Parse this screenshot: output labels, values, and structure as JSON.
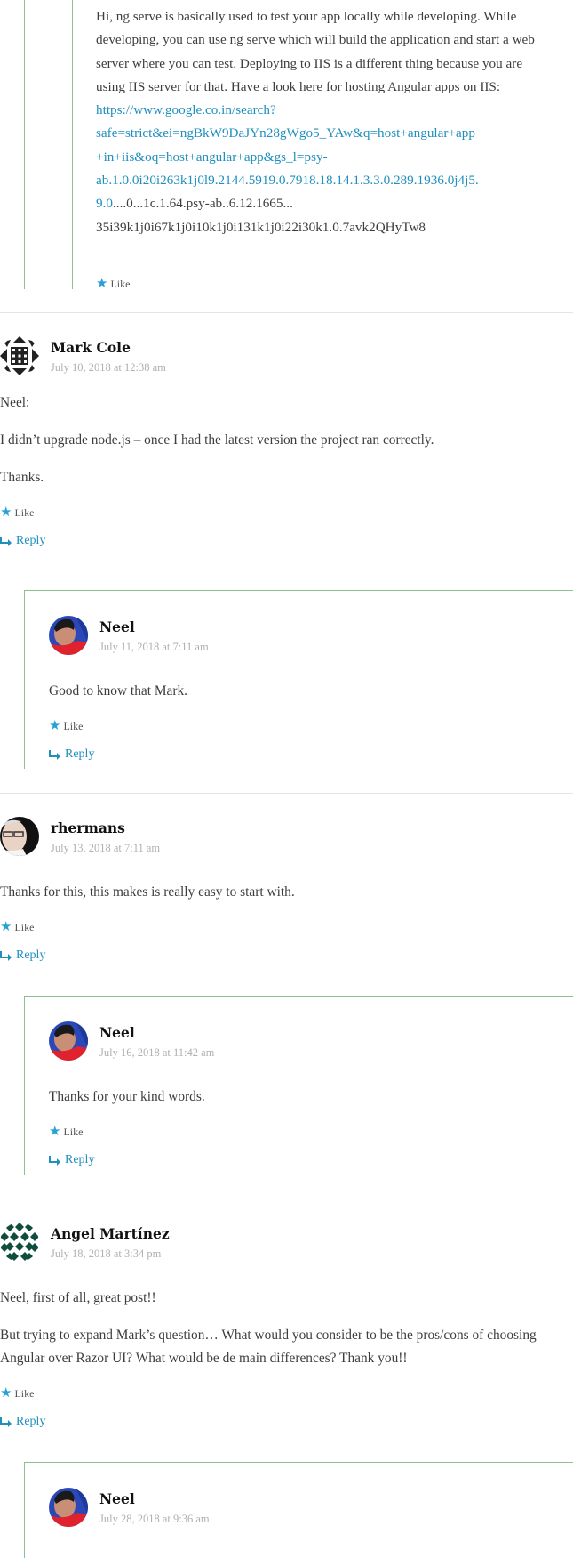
{
  "top_reply": {
    "paragraph_intro": "Hi, ng serve is basically used to test your app locally while developing. While developing, you can use ng serve which will build the application and start a web server where you can test. Deploying to IIS is a different thing because you are using IIS server for that. Have a look here for hosting Angular apps on IIS:",
    "link_text_lines": [
      "https://www.google.co.in/search?",
      "safe=strict&ei=ngBkW9DaJYn28gWgo5_YAw&q=host+angular+app",
      "+in+iis&oq=host+angular+app&gs_l=psy-",
      "ab.1.0.0i20i263k1j0l9.2144.5919.0.7918.18.14.1.3.3.0.289.1936.0j4j5.",
      "9.0"
    ],
    "trailing_text_lines": [
      "....0...1c.1.64.psy-ab..6.12.1665...",
      "35i39k1j0i67k1j0i10k1j0i131k1j0i22i30k1.0.7avk2QHyTw8"
    ],
    "like_label": "Like"
  },
  "comments": [
    {
      "author": "Mark Cole",
      "date": "July 10, 2018 at 12:38 am",
      "avatar": "geometric-identicon-black",
      "paragraphs": [
        "Neel:",
        "I didn’t upgrade node.js – once I had the latest version the project ran correctly.",
        "Thanks."
      ],
      "like_label": "Like",
      "reply_label": "Reply",
      "replies": [
        {
          "author": "Neel",
          "date": "July 11, 2018 at 7:11 am",
          "avatar": "photo-neel",
          "paragraphs": [
            "Good to know that Mark."
          ],
          "like_label": "Like",
          "reply_label": "Reply"
        }
      ]
    },
    {
      "author": "rhermans",
      "date": "July 13, 2018 at 7:11 am",
      "avatar": "photo-rhermans",
      "paragraphs": [
        "Thanks for this, this makes is really easy to start with."
      ],
      "like_label": "Like",
      "reply_label": "Reply",
      "replies": [
        {
          "author": "Neel",
          "date": "July 16, 2018 at 11:42 am",
          "avatar": "photo-neel",
          "paragraphs": [
            "Thanks for your kind words."
          ],
          "like_label": "Like",
          "reply_label": "Reply"
        }
      ]
    },
    {
      "author": "Angel Martínez",
      "date": "July 18, 2018 at 3:34 pm",
      "avatar": "geometric-identicon-green",
      "paragraphs": [
        "Neel, first of all, great post!!",
        "But trying to expand Mark’s question… What would you consider to be the pros/cons of choosing Angular over Razor UI? What would be de main differences? Thank you!!"
      ],
      "like_label": "Like",
      "reply_label": "Reply",
      "replies": [
        {
          "author": "Neel",
          "date": "July 28, 2018 at 9:36 am",
          "avatar": "photo-neel"
        }
      ]
    }
  ],
  "colors": {
    "link": "#1f8fbe",
    "star": "#2aa1d3",
    "thread_border": "#8cc08f",
    "separator": "#e4e4e4",
    "date": "#b0b0b0",
    "identicon_green": "#0f4d3c"
  }
}
